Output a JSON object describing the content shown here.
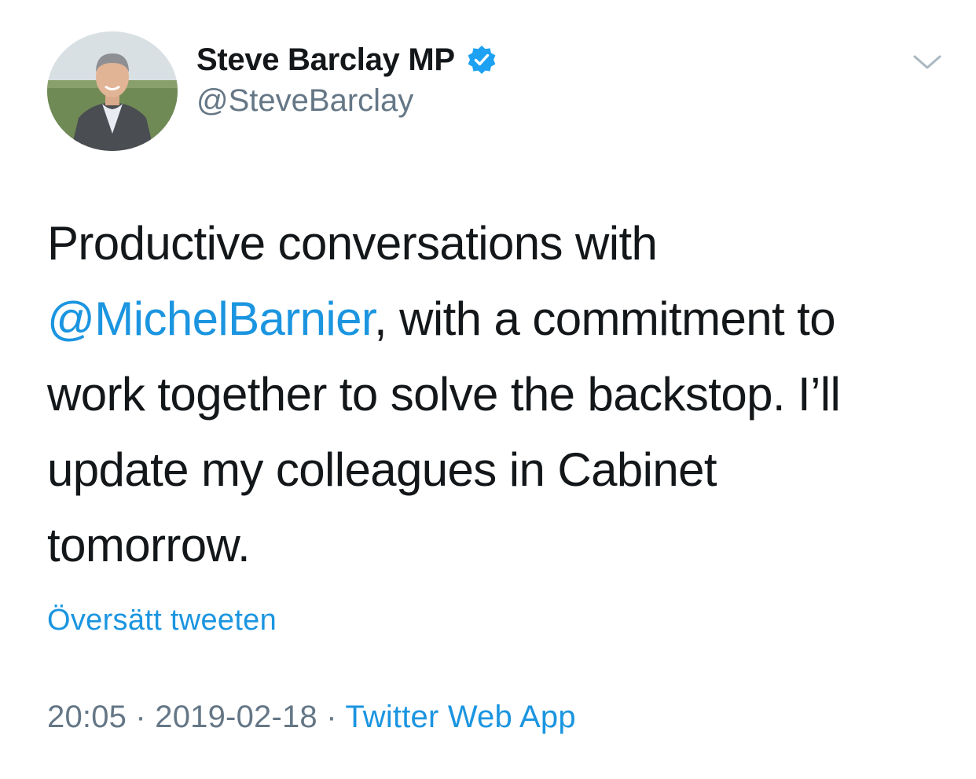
{
  "colors": {
    "text": "#14171a",
    "secondary": "#657786",
    "link": "#1b95e0",
    "verified": "#1da1f2"
  },
  "author": {
    "display_name": "Steve Barclay MP",
    "handle": "@SteveBarclay",
    "verified": true,
    "verified_icon": "verified-badge-icon",
    "avatar": "profile-photo"
  },
  "menu_icon": "chevron-down-icon",
  "tweet": {
    "text_before": "Productive conversations with ",
    "mention": "@MichelBarnier",
    "text_after": ", with a commitment to work together to solve the backstop. I’ll update my colleagues in Cabinet tomorrow."
  },
  "translate_label": "Översätt tweeten",
  "meta": {
    "time": "20:05",
    "separator": " · ",
    "date": "2019-02-18",
    "source": "Twitter Web App"
  }
}
